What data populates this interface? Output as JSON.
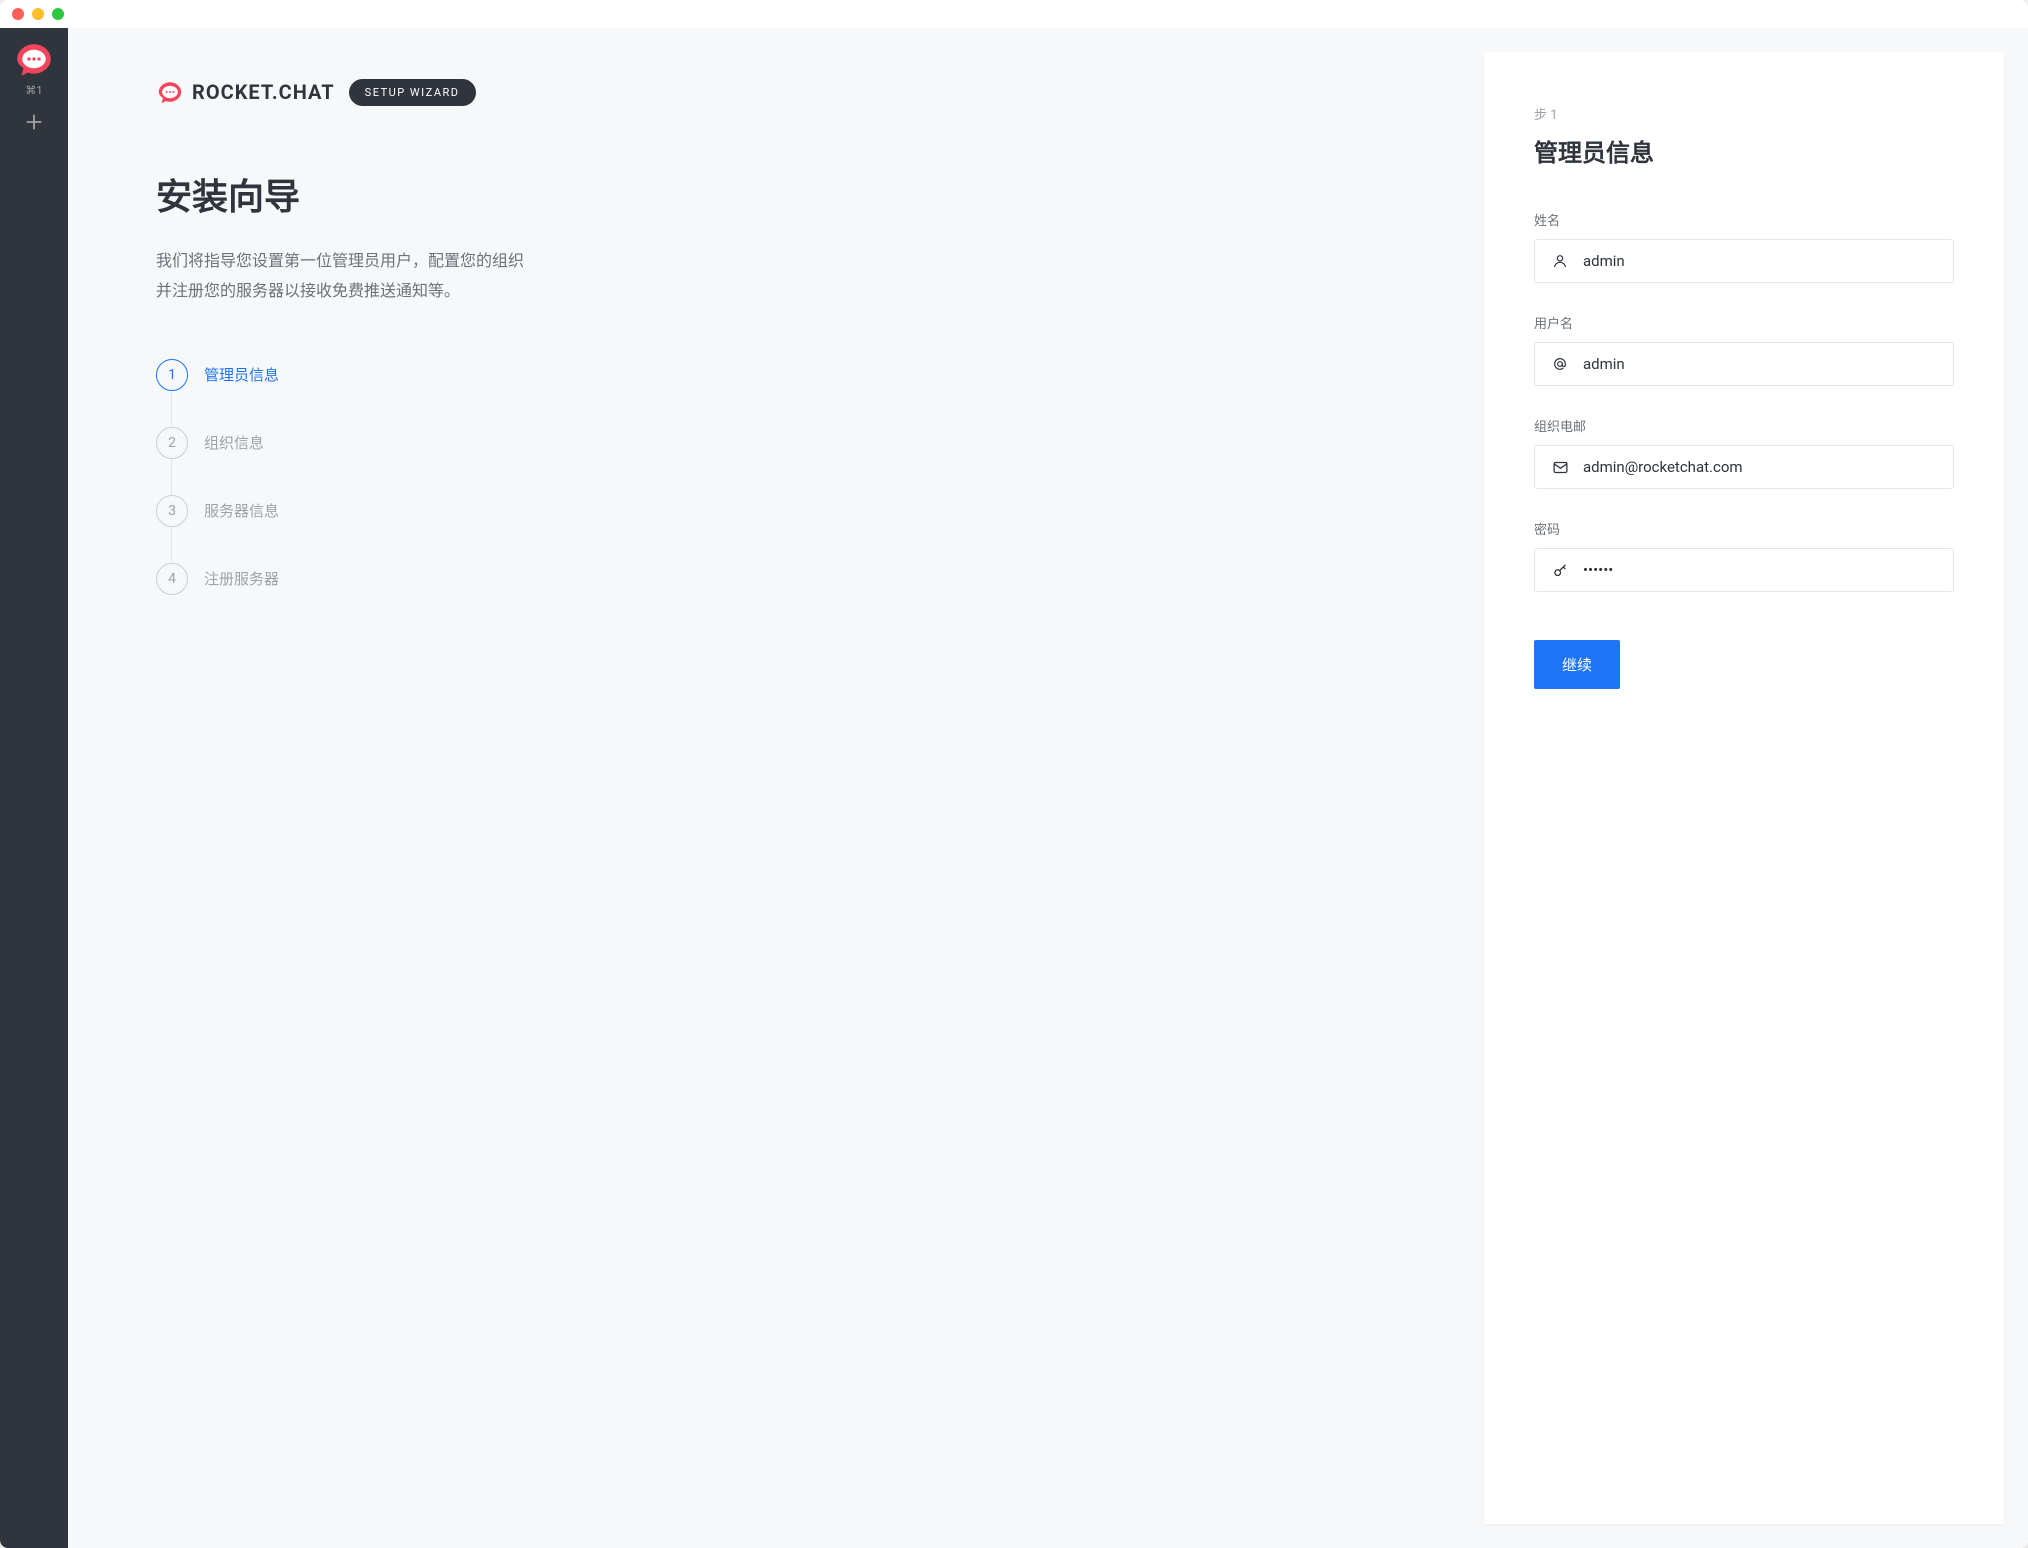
{
  "sidebar": {
    "shortcut": "⌘1"
  },
  "brand": {
    "name": "ROCKET.CHAT",
    "badge": "SETUP WIZARD"
  },
  "wizard": {
    "title": "安装向导",
    "description": "我们将指导您设置第一位管理员用户，配置您的组织并注册您的服务器以接收免费推送通知等。"
  },
  "steps": [
    {
      "num": "1",
      "label": "管理员信息",
      "active": true
    },
    {
      "num": "2",
      "label": "组织信息",
      "active": false
    },
    {
      "num": "3",
      "label": "服务器信息",
      "active": false
    },
    {
      "num": "4",
      "label": "注册服务器",
      "active": false
    }
  ],
  "form": {
    "step_label": "步 1",
    "title": "管理员信息",
    "fields": {
      "name": {
        "label": "姓名",
        "value": "admin"
      },
      "username": {
        "label": "用户名",
        "value": "admin"
      },
      "email": {
        "label": "组织电邮",
        "value": "admin@rocketchat.com"
      },
      "password": {
        "label": "密码",
        "value": "••••••"
      }
    },
    "continue": "继续"
  }
}
